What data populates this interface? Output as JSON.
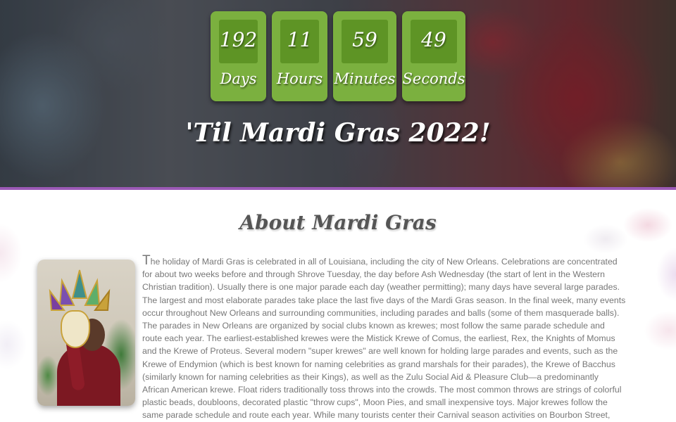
{
  "countdown": [
    {
      "value": "192",
      "unit": "Days"
    },
    {
      "value": "11",
      "unit": "Hours"
    },
    {
      "value": "59",
      "unit": "Minutes"
    },
    {
      "value": "49",
      "unit": "Seconds"
    }
  ],
  "hero": {
    "title": "'Til Mardi Gras 2022!"
  },
  "about": {
    "title": "About Mardi Gras",
    "dropcap": "T",
    "body": "he holiday of Mardi Gras is celebrated in all of Louisiana, including the city of New Orleans. Celebrations are concentrated for about two weeks before and through Shrove Tuesday, the day before Ash Wednesday (the start of lent in the Western Christian tradition). Usually there is one major parade each day (weather permitting); many days have several large parades. The largest and most elaborate parades take place the last five days of the Mardi Gras season. In the final week, many events occur throughout New Orleans and surrounding communities, including parades and balls (some of them masquerade balls). The parades in New Orleans are organized by social clubs known as krewes; most follow the same parade schedule and route each year. The earliest-established krewes were the Mistick Krewe of Comus, the earliest, Rex, the Knights of Momus and the Krewe of Proteus. Several modern \"super krewes\" are well known for holding large parades and events, such as the Krewe of Endymion (which is best known for naming celebrities as grand marshals for their parades), the Krewe of Bacchus (similarly known for naming celebrities as their Kings), as well as the Zulu Social Aid & Pleasure Club—a predominantly African American krewe. Float riders traditionally toss throws into the crowds. The most common throws are strings of colorful plastic beads, doubloons, decorated plastic \"throw cups\", Moon Pies, and small inexpensive toys. Major krewes follow the same parade schedule and route each year. While many tourists center their Carnival season activities on Bourbon Street, major parades originate in the Uptown and Mid-"
  },
  "colors": {
    "countdown_box": "#7bb03f",
    "countdown_inner": "#5e9425",
    "accent_border": "#9b59b6",
    "body_text": "#777777",
    "heading_text": "#555555"
  }
}
